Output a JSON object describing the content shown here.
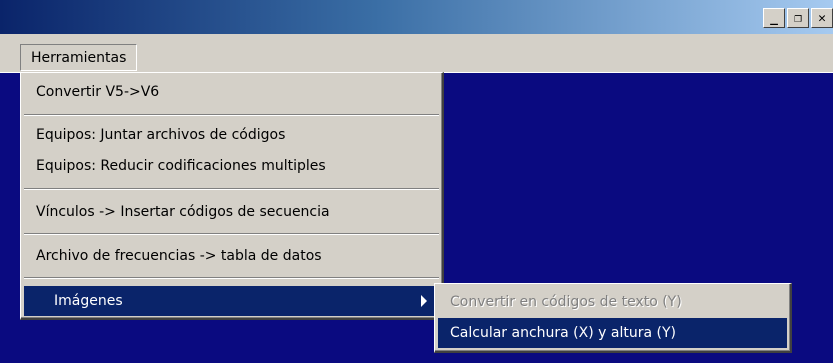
{
  "window": {
    "caption_buttons": {
      "minimize": "_",
      "restore": "❐",
      "close": "✕"
    }
  },
  "menubar": {
    "menu_title": "Herramientas"
  },
  "menu": {
    "items": [
      {
        "label": "Convertir V5->V6"
      },
      {
        "label": "Equipos: Juntar archivos de códigos"
      },
      {
        "label": "Equipos: Reducir codificaciones multiples"
      },
      {
        "label": "Vínculos -> Insertar códigos de secuencia"
      },
      {
        "label": "Archivo de frecuencias -> tabla de datos"
      },
      {
        "label": "Imágenes",
        "has_submenu": true
      }
    ]
  },
  "submenu": {
    "items": [
      {
        "label": "Convertir en códigos de texto (Y)",
        "disabled": true
      },
      {
        "label": "Calcular anchura (X) y altura (Y)",
        "selected": true
      }
    ]
  },
  "colors": {
    "desktop_blue": "#0a0a80",
    "highlight": "#0a246a",
    "menu_face": "#d4d0c8"
  }
}
